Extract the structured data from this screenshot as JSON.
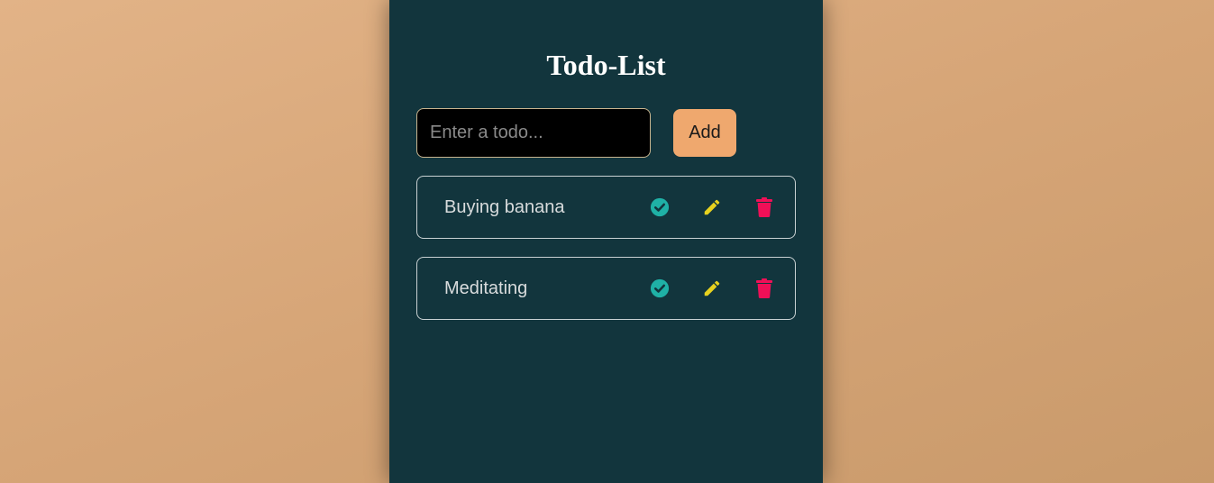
{
  "app": {
    "title": "Todo-List"
  },
  "form": {
    "input_value": "",
    "input_placeholder": "Enter a todo...",
    "add_label": "Add"
  },
  "todos": [
    {
      "text": "Buying banana"
    },
    {
      "text": "Meditating"
    }
  ],
  "icons": {
    "complete": "check-circle-icon",
    "edit": "pencil-icon",
    "delete": "trash-icon"
  },
  "colors": {
    "background_gradient": [
      "#e2b387",
      "#c99a6b"
    ],
    "panel": "#12353d",
    "accent_button": "#efa86e",
    "check": "#1fb1a6",
    "edit": "#e7d21f",
    "delete": "#f00f57"
  }
}
